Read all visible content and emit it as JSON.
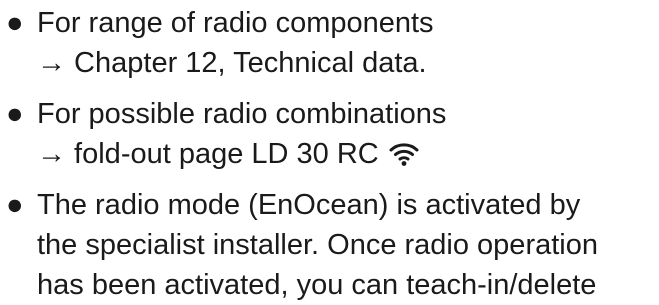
{
  "bullet_glyph": "●",
  "items": [
    {
      "line1": "For range of radio components",
      "line2": "→ Chapter 12, Technical data."
    },
    {
      "line1": "For possible radio combinations",
      "line2": "→ fold-out page LD 30 RC",
      "icon": "wifi-icon"
    },
    {
      "line1": "The radio mode (EnOcean) is activated by",
      "line2": "the specialist installer. Once radio operation",
      "line3": "has been activated, you can teach-in/delete"
    }
  ]
}
